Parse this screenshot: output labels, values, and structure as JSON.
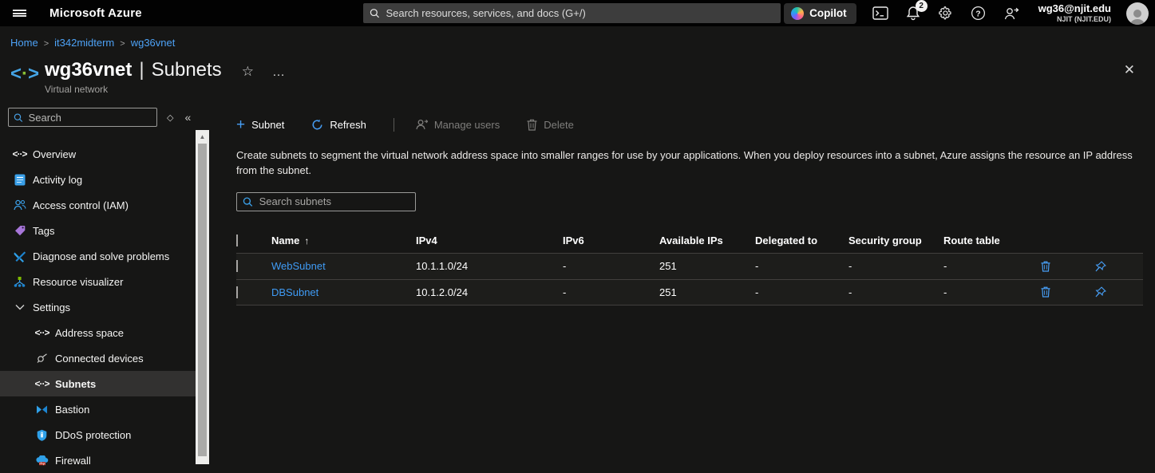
{
  "topbar": {
    "product": "Microsoft Azure",
    "search_placeholder": "Search resources, services, and docs (G+/)",
    "copilot_label": "Copilot",
    "notification_count": "2",
    "user": {
      "email": "wg36@njit.edu",
      "tenant": "NJIT (NJIT.EDU)"
    }
  },
  "breadcrumb": {
    "home": "Home",
    "parent": "it342midterm",
    "current": "wg36vnet",
    "separator": "›"
  },
  "blade": {
    "title": "wg36vnet",
    "separator": "|",
    "section": "Subnets",
    "subtitle": "Virtual network",
    "star": "☆",
    "ellipsis": "…",
    "close": "✕"
  },
  "sidebar": {
    "search_placeholder": "Search",
    "items": [
      {
        "label": "Overview"
      },
      {
        "label": "Activity log"
      },
      {
        "label": "Access control (IAM)"
      },
      {
        "label": "Tags"
      },
      {
        "label": "Diagnose and solve problems"
      },
      {
        "label": "Resource visualizer"
      },
      {
        "label": "Settings"
      },
      {
        "label": "Address space"
      },
      {
        "label": "Connected devices"
      },
      {
        "label": "Subnets"
      },
      {
        "label": "Bastion"
      },
      {
        "label": "DDoS protection"
      },
      {
        "label": "Firewall"
      }
    ]
  },
  "toolbar": {
    "subnet": "Subnet",
    "refresh": "Refresh",
    "manage_users": "Manage users",
    "delete": "Delete"
  },
  "content": {
    "description": "Create subnets to segment the virtual network address space into smaller ranges for use by your applications. When you deploy resources into a subnet, Azure assigns the resource an IP address from the subnet.",
    "search_placeholder": "Search subnets"
  },
  "table": {
    "columns": [
      "Name",
      "IPv4",
      "IPv6",
      "Available IPs",
      "Delegated to",
      "Security group",
      "Route table"
    ],
    "sort_indicator": "↑",
    "rows": [
      {
        "name": "WebSubnet",
        "ipv4": "10.1.1.0/24",
        "ipv6": "-",
        "available_ips": "251",
        "delegated_to": "-",
        "security_group": "-",
        "route_table": "-"
      },
      {
        "name": "DBSubnet",
        "ipv4": "10.1.2.0/24",
        "ipv6": "-",
        "available_ips": "251",
        "delegated_to": "-",
        "security_group": "-",
        "route_table": "-"
      }
    ]
  },
  "colors": {
    "accent": "#479ef5",
    "link": "#3f9bf5",
    "topbar": "#020202",
    "selected_item": "#323130"
  }
}
